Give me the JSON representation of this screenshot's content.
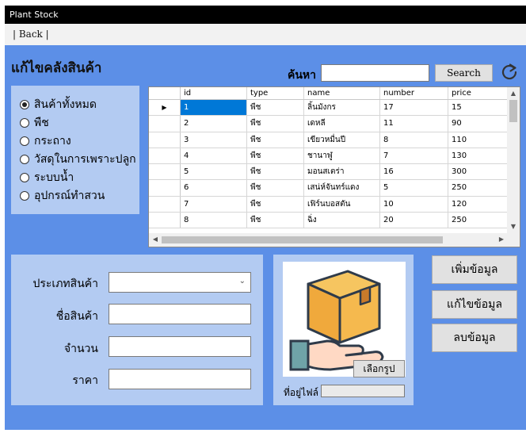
{
  "window": {
    "title": "Plant Stock"
  },
  "menu": {
    "back_label": "| Back |"
  },
  "heading": "แก้ไขคลังสินค้า",
  "search": {
    "label": "ค้นหา",
    "value": "",
    "button_label": "Search"
  },
  "categories": [
    {
      "label": "สินค้าทั้งหมด",
      "checked": true
    },
    {
      "label": "พืช",
      "checked": false
    },
    {
      "label": "กระถาง",
      "checked": false
    },
    {
      "label": "วัสดุในการเพราะปลูก",
      "checked": false
    },
    {
      "label": "ระบบน้ำ",
      "checked": false
    },
    {
      "label": "อุปกรณ์ทำสวน",
      "checked": false
    }
  ],
  "grid": {
    "columns": [
      "id",
      "type",
      "name",
      "number",
      "price"
    ],
    "rows": [
      {
        "id": "1",
        "type": "พืช",
        "name": "ลิ้นมังกร",
        "number": "17",
        "price": "15"
      },
      {
        "id": "2",
        "type": "พืช",
        "name": "เดหลี",
        "number": "11",
        "price": "90"
      },
      {
        "id": "3",
        "type": "พืช",
        "name": "เขียวหมื่นปี",
        "number": "8",
        "price": "110"
      },
      {
        "id": "4",
        "type": "พืช",
        "name": "ชานาฬู",
        "number": "7",
        "price": "130"
      },
      {
        "id": "5",
        "type": "พืช",
        "name": "มอนสเตร่า",
        "number": "16",
        "price": "300"
      },
      {
        "id": "6",
        "type": "พืช",
        "name": "เสน่ห์จันทร์แดง",
        "number": "5",
        "price": "250"
      },
      {
        "id": "7",
        "type": "พืช",
        "name": "เฟิร์นบอสตัน",
        "number": "10",
        "price": "120"
      },
      {
        "id": "8",
        "type": "พืช",
        "name": "ฉิ่ง",
        "number": "20",
        "price": "250"
      }
    ]
  },
  "form": {
    "type_label": "ประเภทสินค้า",
    "name_label": "ชื่อสินค้า",
    "quantity_label": "จำนวน",
    "price_label": "ราคา"
  },
  "image": {
    "choose_label": "เลือกรูป",
    "path_label": "ที่อยู่ไฟล์"
  },
  "actions": {
    "add_label": "เพิ่มข้อมูล",
    "edit_label": "แก้ไขข้อมูล",
    "delete_label": "ลบข้อมูล"
  },
  "colors": {
    "background": "#5c8fe7",
    "panel": "#b3cbf2",
    "titlebar": "#000000",
    "selection": "#0078d7"
  }
}
